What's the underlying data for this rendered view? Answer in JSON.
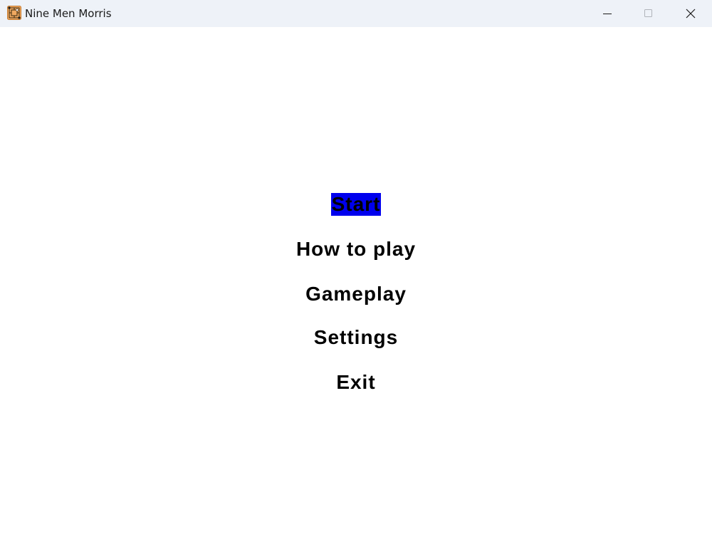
{
  "window": {
    "title": "Nine Men Morris",
    "app_icon": "board-icon",
    "controls": {
      "minimize_icon": "minimize-icon",
      "maximize_icon": "maximize-icon",
      "close_icon": "close-icon"
    }
  },
  "menu": {
    "items": [
      {
        "label": "Start",
        "selected": true
      },
      {
        "label": "How to play",
        "selected": false
      },
      {
        "label": "Gameplay",
        "selected": false
      },
      {
        "label": "Settings",
        "selected": false
      },
      {
        "label": "Exit",
        "selected": false
      }
    ],
    "highlight_color": "#0000ee",
    "text_color": "#000000"
  }
}
